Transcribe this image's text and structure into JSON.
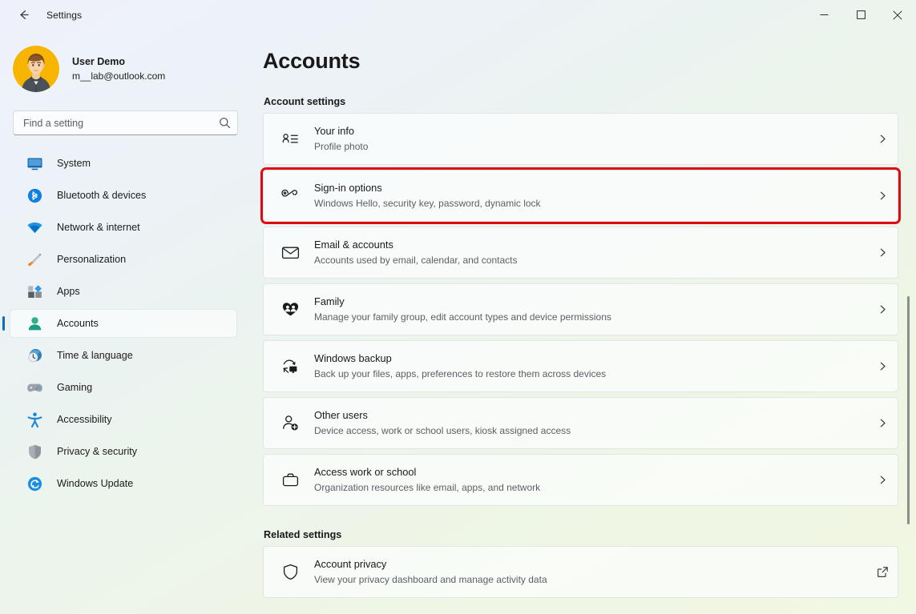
{
  "window": {
    "app_title": "Settings",
    "back_icon": "arrow-left-icon",
    "caption": {
      "minimize": "minimize-icon",
      "maximize": "maximize-icon",
      "close": "close-icon"
    },
    "background_top_color": "#eef1fb",
    "background_bottom_color": "#f0f7e2"
  },
  "sidebar": {
    "account": {
      "name": "User Demo",
      "email": "m__lab@outlook.com",
      "avatar_icon": "user-avatar",
      "avatar_bg_color": "#f5b600"
    },
    "search": {
      "placeholder": "Find a setting",
      "value": "",
      "icon": "search-icon"
    },
    "items": [
      {
        "label": "System",
        "icon": "monitor-icon",
        "color": "#1263a8",
        "selected": false
      },
      {
        "label": "Bluetooth & devices",
        "icon": "bluetooth-icon",
        "color": "#0f7fe0",
        "selected": false
      },
      {
        "label": "Network & internet",
        "icon": "wifi-icon",
        "color": "#0f8ee0",
        "selected": false
      },
      {
        "label": "Personalization",
        "icon": "paintbrush-icon",
        "color": "#8c8c94",
        "selected": false
      },
      {
        "label": "Apps",
        "icon": "apps-icon",
        "color": "#4a4a52",
        "selected": false
      },
      {
        "label": "Accounts",
        "icon": "person-icon",
        "color": "#2aa98a",
        "selected": true
      },
      {
        "label": "Time & language",
        "icon": "clock-globe-icon",
        "color": "#2a7ab0",
        "selected": false
      },
      {
        "label": "Gaming",
        "icon": "gamepad-icon",
        "color": "#8e939b",
        "selected": false
      },
      {
        "label": "Accessibility",
        "icon": "accessibility-icon",
        "color": "#1a86d9",
        "selected": false
      },
      {
        "label": "Privacy & security",
        "icon": "shield-icon",
        "color": "#9aa0a6",
        "selected": false
      },
      {
        "label": "Windows Update",
        "icon": "update-icon",
        "color": "#0f8ee0",
        "selected": false
      }
    ],
    "selection_accent_color": "#0f6cbd"
  },
  "main": {
    "page_title": "Accounts",
    "sections": [
      {
        "heading": "Account settings",
        "rows": [
          {
            "title": "Your info",
            "subtitle": "Profile photo",
            "icon": "contact-info-icon",
            "action_icon": "chevron-right-icon",
            "highlighted": false
          },
          {
            "title": "Sign-in options",
            "subtitle": "Windows Hello, security key, password, dynamic lock",
            "icon": "key-icon",
            "action_icon": "chevron-right-icon",
            "highlighted": true
          },
          {
            "title": "Email & accounts",
            "subtitle": "Accounts used by email, calendar, and contacts",
            "icon": "envelope-icon",
            "action_icon": "chevron-right-icon",
            "highlighted": false
          },
          {
            "title": "Family",
            "subtitle": "Manage your family group, edit account types and device permissions",
            "icon": "family-heart-icon",
            "action_icon": "chevron-right-icon",
            "highlighted": false
          },
          {
            "title": "Windows backup",
            "subtitle": "Back up your files, apps, preferences to restore them across devices",
            "icon": "backup-sync-icon",
            "action_icon": "chevron-right-icon",
            "highlighted": false
          },
          {
            "title": "Other users",
            "subtitle": "Device access, work or school users, kiosk assigned access",
            "icon": "person-add-icon",
            "action_icon": "chevron-right-icon",
            "highlighted": false
          },
          {
            "title": "Access work or school",
            "subtitle": "Organization resources like email, apps, and network",
            "icon": "briefcase-icon",
            "action_icon": "chevron-right-icon",
            "highlighted": false
          }
        ]
      },
      {
        "heading": "Related settings",
        "rows": [
          {
            "title": "Account privacy",
            "subtitle": "View your privacy dashboard and manage activity data",
            "icon": "shield-outline-icon",
            "action_icon": "external-link-icon",
            "highlighted": false
          }
        ]
      }
    ],
    "highlight_color": "#e00b12"
  },
  "scrollbar": {
    "thumb_color": "#8a8f8a"
  }
}
